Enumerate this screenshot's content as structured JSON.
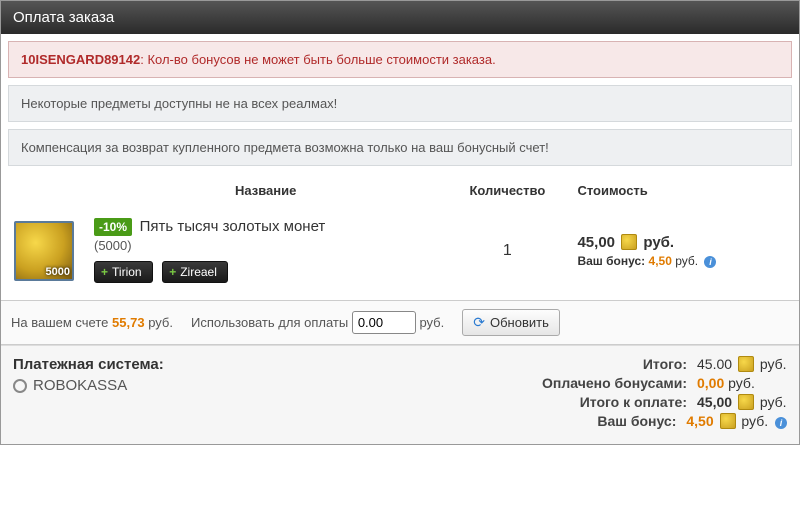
{
  "title": "Оплата заказа",
  "alerts": {
    "error_code": "10ISENGARD89142",
    "error_msg": ": Кол-во бонусов не может быть больше стоимости заказа.",
    "info1": "Некоторые предметы доступны не на всех реалмах!",
    "info2": "Компенсация за возврат купленного предмета возможна только на ваш бонусный счет!"
  },
  "table": {
    "h_name": "Название",
    "h_qty": "Количество",
    "h_price": "Стоимость"
  },
  "item": {
    "icon_count": "5000",
    "discount": "-10%",
    "title": "Пять тысяч золотых монет",
    "sub": "(5000)",
    "servers": [
      "Tirion",
      "Zireael"
    ],
    "qty": "1",
    "price": "45,00",
    "currency": "руб.",
    "bonus_label": "Ваш бонус:",
    "bonus_value": "4,50"
  },
  "balance": {
    "label_prefix": "На вашем счете",
    "amount": "55,73",
    "label_suffix": "руб.",
    "use_label": "Использовать для оплаты",
    "input_value": "0.00",
    "use_suffix": "руб.",
    "refresh": "Обновить"
  },
  "summary": {
    "paysys_label": "Платежная система:",
    "paysys_option": "ROBOKASSA",
    "total_label": "Итого:",
    "total_value": "45.00",
    "paid_bonus_label": "Оплачено бонусами:",
    "paid_bonus_value": "0,00",
    "to_pay_label": "Итого к оплате:",
    "to_pay_value": "45,00",
    "your_bonus_label": "Ваш бонус:",
    "your_bonus_value": "4,50",
    "currency": "руб."
  }
}
